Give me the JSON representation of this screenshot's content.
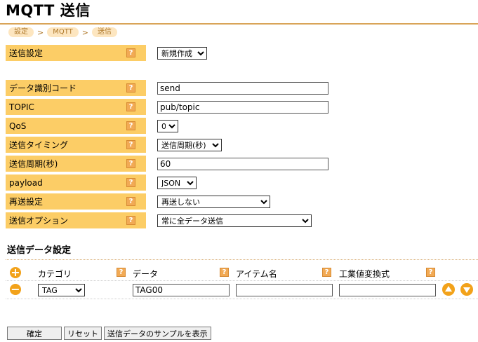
{
  "page": {
    "title": "MQTT 送信"
  },
  "breadcrumb": [
    "設定",
    "MQTT",
    "送信"
  ],
  "breadcrumb_sep": ">",
  "help_glyph": "?",
  "form": {
    "send_setting": {
      "label": "送信設定",
      "value": "新規作成"
    },
    "data_id_code": {
      "label": "データ識別コード",
      "value": "send"
    },
    "topic": {
      "label": "TOPIC",
      "value": "pub/topic"
    },
    "qos": {
      "label": "QoS",
      "value": "0"
    },
    "send_timing": {
      "label": "送信タイミング",
      "value": "送信周期(秒)"
    },
    "send_period": {
      "label": "送信周期(秒)",
      "value": "60"
    },
    "payload": {
      "label": "payload",
      "value": "JSON"
    },
    "resend_setting": {
      "label": "再送設定",
      "value": "再送しない"
    },
    "send_option": {
      "label": "送信オプション",
      "value": "常に全データ送信"
    }
  },
  "send_data": {
    "title": "送信データ設定",
    "columns": [
      "カテゴリ",
      "データ",
      "アイテム名",
      "工業値変換式"
    ],
    "rows": [
      {
        "category": "TAG",
        "data": "TAG00",
        "item_name": "",
        "conversion": ""
      }
    ]
  },
  "footer": {
    "confirm": "確定",
    "reset": "リセット",
    "show_sample": "送信データのサンプルを表示"
  },
  "colors": {
    "label_bg": "#fccd66",
    "accent": "#f2a21a",
    "rule": "#d9a458"
  }
}
